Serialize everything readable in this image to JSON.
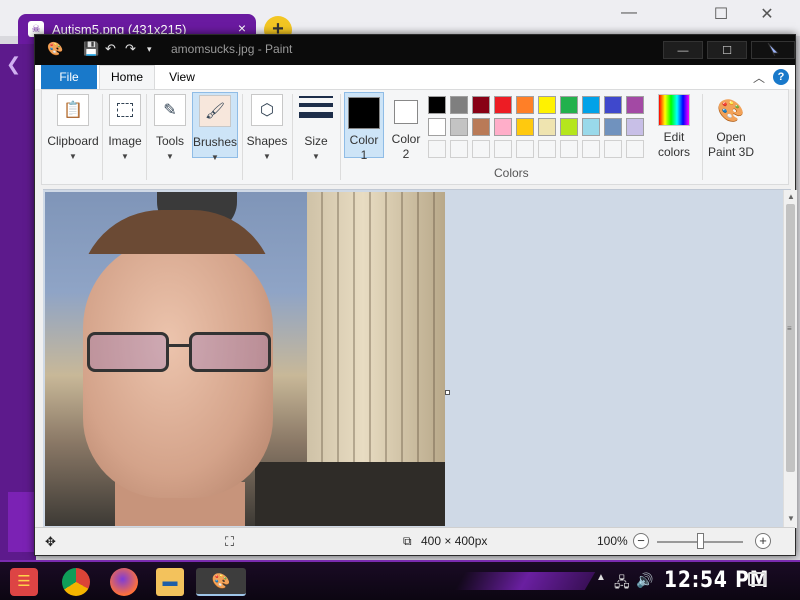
{
  "background_browser": {
    "tab_title": "Autism5.png (431x215)",
    "tab_close": "×",
    "new_tab": "+",
    "controls": [
      "—",
      "☐",
      "✕"
    ]
  },
  "paint": {
    "window_title": "amomsucks.jpg - Paint",
    "quick_access_icons": [
      "paint-logo-icon",
      "save-icon",
      "undo-icon",
      "redo-icon",
      "customize-icon"
    ],
    "window_controls": {
      "minimize": "—",
      "maximize": "☐"
    },
    "ribbon_tabs": {
      "file": "File",
      "home": "Home",
      "view": "View"
    },
    "help": "?",
    "groups": {
      "clipboard": "Clipboard",
      "image": "Image",
      "tools": "Tools",
      "brushes": "Brushes",
      "shapes": "Shapes",
      "size": "Size",
      "color1_label": "Color",
      "color1_num": "1",
      "color2_label": "Color",
      "color2_num": "2",
      "edit_colors_line1": "Edit",
      "edit_colors_line2": "colors",
      "open_paint3d_line1": "Open",
      "open_paint3d_line2": "Paint 3D",
      "colors_group": "Colors"
    },
    "color1_value": "#000000",
    "color2_value": "#ffffff",
    "palette_row1": [
      "#000000",
      "#7f7f7f",
      "#880015",
      "#ed1c24",
      "#ff7f27",
      "#fff200",
      "#22b14c",
      "#00a2e8",
      "#3f48cc",
      "#a349a4"
    ],
    "palette_row2": [
      "#ffffff",
      "#c3c3c3",
      "#b97a57",
      "#ffaec9",
      "#ffc90e",
      "#efe4b0",
      "#b5e61d",
      "#99d9ea",
      "#7092be",
      "#c8bfe7"
    ],
    "status": {
      "image_size": "400 × 400px",
      "zoom": "100%",
      "zoom_minus": "−",
      "zoom_plus": "+"
    }
  },
  "taskbar": {
    "clock": "12:54 PM",
    "apps": [
      "start-icon",
      "chrome-icon",
      "firefox-icon",
      "file-explorer-icon",
      "paint-icon"
    ]
  }
}
